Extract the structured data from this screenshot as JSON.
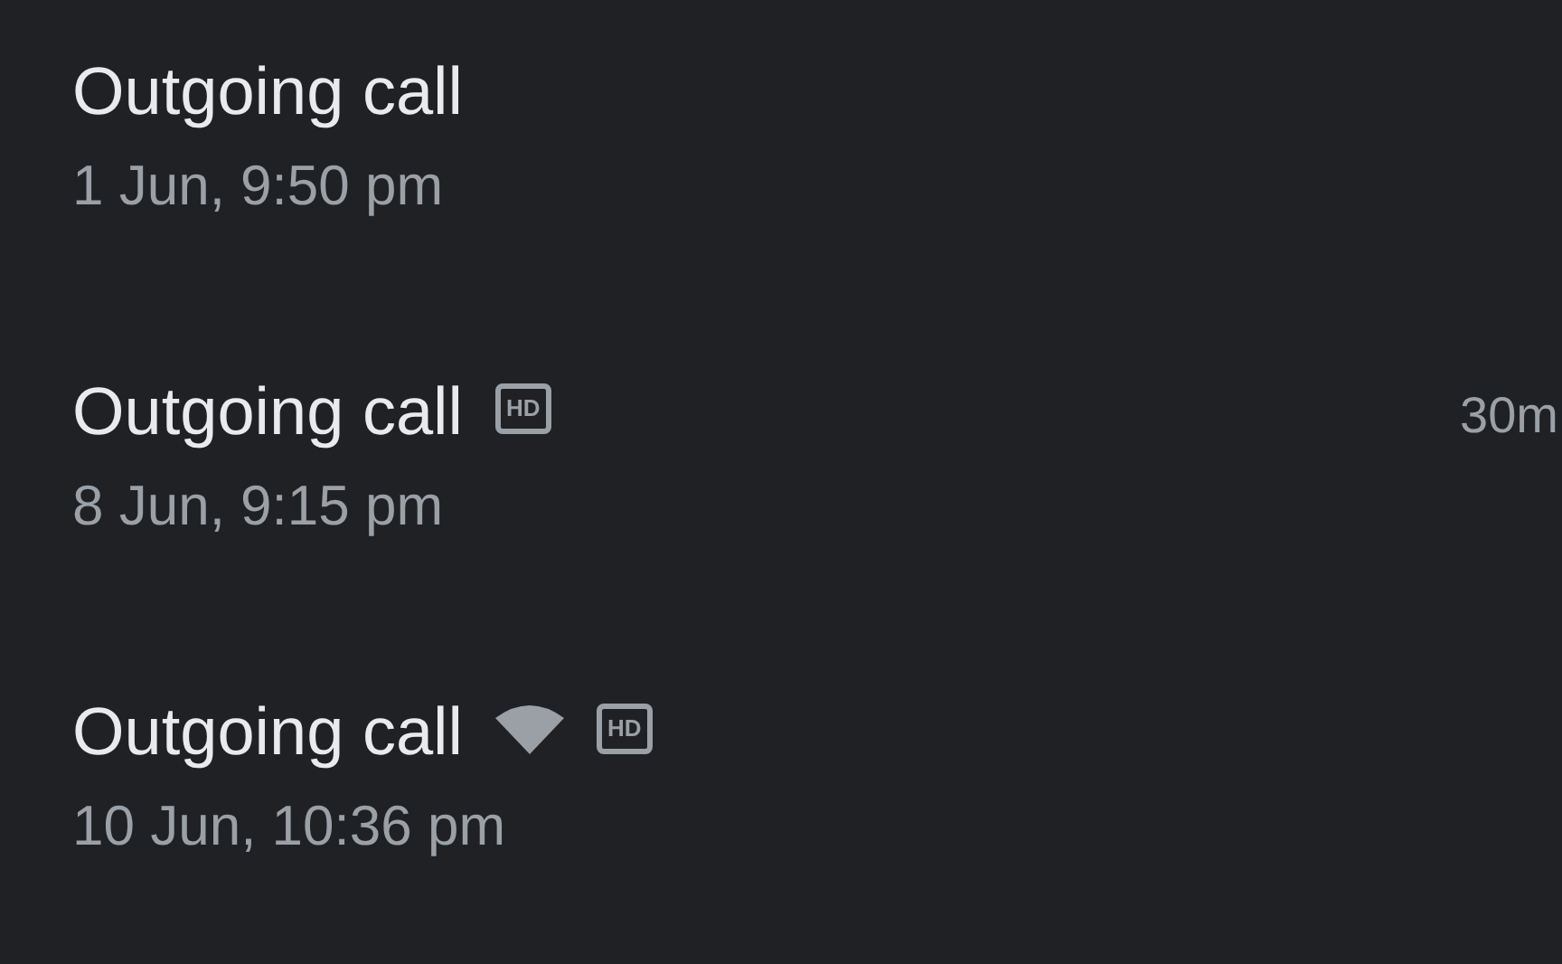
{
  "calls": [
    {
      "title": "Outgoing call",
      "time": "1 Jun, 9:50 pm",
      "wifi": false
    },
    {
      "title": "Outgoing call",
      "time": "8 Jun, 9:15 pm",
      "wifi": false,
      "badges": [
        "HD"
      ],
      "duration": "30m"
    },
    {
      "title": "Outgoing call",
      "time": "10 Jun, 10:36 pm",
      "wifi": true,
      "badges": [
        "HD"
      ]
    }
  ]
}
